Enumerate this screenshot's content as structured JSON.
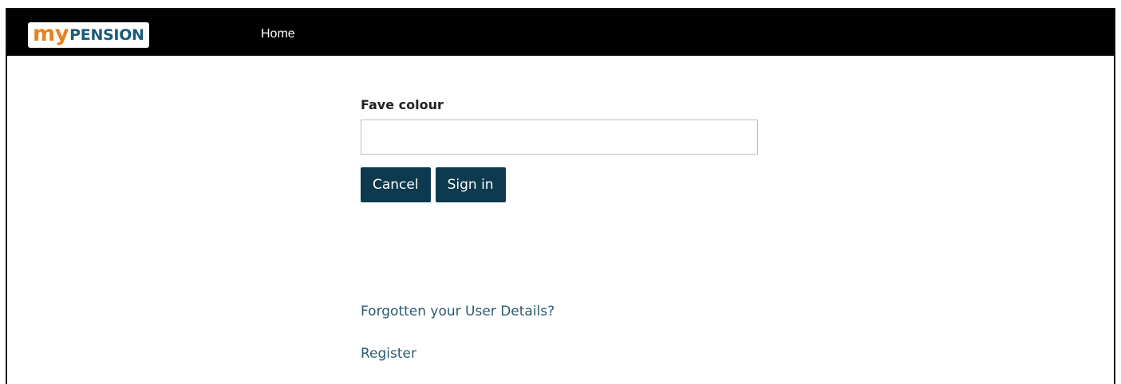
{
  "navbar": {
    "logo": {
      "my": "my",
      "pension": "PENSION"
    },
    "home_label": "Home"
  },
  "form": {
    "field_label": "Fave colour",
    "field_value": "",
    "cancel_label": "Cancel",
    "signin_label": "Sign in"
  },
  "links": {
    "forgotten_label": "Forgotten your User Details?",
    "register_label": "Register"
  },
  "colors": {
    "navbar_bg": "#000000",
    "logo_orange": "#e8821e",
    "logo_blue": "#1a5a7a",
    "button_bg": "#0d3a4e",
    "link_color": "#2b5b70"
  }
}
